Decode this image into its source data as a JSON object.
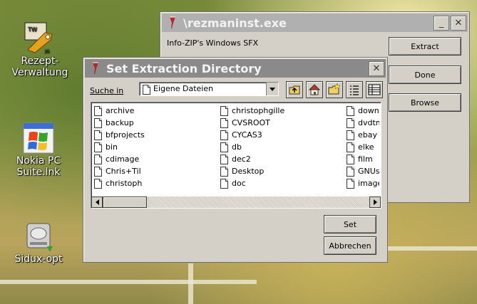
{
  "desktop": {
    "icons": [
      {
        "label_line1": "Rezept-",
        "label_line2": "Verwaltung",
        "icon": "recipe-app-icon"
      },
      {
        "label_line1": "Nokia PC",
        "label_line2": "Suite.lnk",
        "icon": "windows-logo-icon"
      },
      {
        "label_line1": "Sidux-opt",
        "label_line2": "",
        "icon": "hard-drive-icon"
      }
    ]
  },
  "sfx_window": {
    "title": "\\rezmaninst.exe",
    "description": "Info-ZIP's Windows SFX",
    "extract_label": "Extract",
    "done_label": "Done",
    "browse_label": "Browse",
    "minimize_glyph": "_",
    "close_glyph": "✕"
  },
  "dialog": {
    "title": "Set Extraction Directory",
    "close_glyph": "✕",
    "lookin_label": "Suche in",
    "lookin_value": "Eigene Dateien",
    "set_label": "Set",
    "cancel_label": "Abbrechen",
    "files": {
      "col1": [
        "archive",
        "backup",
        "bfprojects",
        "bin",
        "cdimage",
        "Chris+Til",
        "christoph"
      ],
      "col2": [
        "christophgille",
        "CVSROOT",
        "CYCAS3",
        "db",
        "dec2",
        "Desktop",
        "doc"
      ],
      "col3": [
        "downlo",
        "dvdtmp",
        "ebay",
        "elke",
        "film",
        "GNUste",
        "images"
      ]
    }
  }
}
